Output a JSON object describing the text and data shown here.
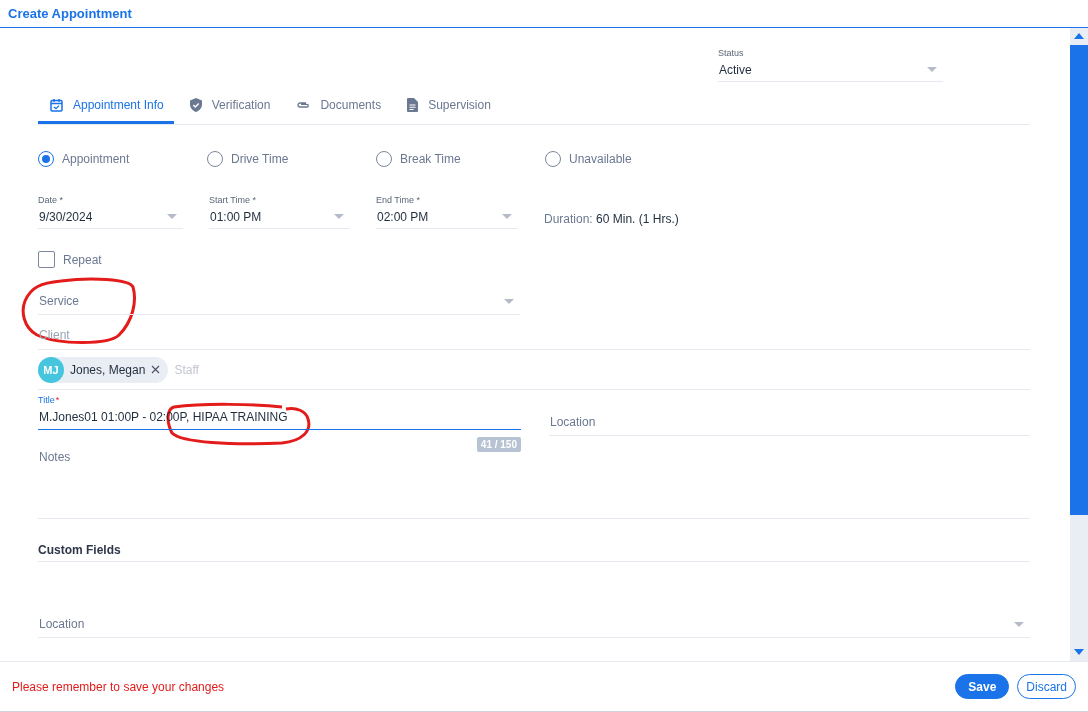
{
  "header": {
    "title": "Create Appointment"
  },
  "status": {
    "label": "Status",
    "value": "Active"
  },
  "tabs": [
    {
      "label": "Appointment Info",
      "kind": "calendar",
      "selected": true
    },
    {
      "label": "Verification",
      "kind": "shield",
      "selected": false
    },
    {
      "label": "Documents",
      "kind": "paperclip",
      "selected": false
    },
    {
      "label": "Supervision",
      "kind": "document",
      "selected": false
    }
  ],
  "types": [
    {
      "label": "Appointment",
      "selected": true
    },
    {
      "label": "Drive Time",
      "selected": false
    },
    {
      "label": "Break Time",
      "selected": false
    },
    {
      "label": "Unavailable",
      "selected": false
    }
  ],
  "time_fields": [
    {
      "label": "Date",
      "required_mark": "*",
      "value": "9/30/2024"
    },
    {
      "label": "Start Time",
      "required_mark": "*",
      "value": "01:00 PM"
    },
    {
      "label": "End Time",
      "required_mark": "*",
      "value": "02:00 PM"
    }
  ],
  "duration": {
    "label": "Duration:",
    "value": "60 Min. (1 Hrs.)"
  },
  "repeat": {
    "label": "Repeat",
    "checked": false
  },
  "service": {
    "placeholder": "Service"
  },
  "client": {
    "placeholder": "Client"
  },
  "staff": {
    "chips": [
      {
        "initials": "MJ",
        "name": "Jones, Megan"
      }
    ],
    "placeholder": "Staff"
  },
  "title_field": {
    "label": "Title",
    "required_mark": "*",
    "value": "M.Jones01 01:00P - 02:00P, HIPAA TRAINING",
    "counter": "41 / 150"
  },
  "location": {
    "placeholder": "Location"
  },
  "notes": {
    "placeholder": "Notes"
  },
  "custom_fields": {
    "heading": "Custom Fields",
    "location": {
      "placeholder": "Location"
    }
  },
  "footer": {
    "message": "Please remember to save your changes",
    "buttons": [
      {
        "label": "Save",
        "kind": "primary"
      },
      {
        "label": "Discard",
        "kind": "outline"
      }
    ]
  }
}
